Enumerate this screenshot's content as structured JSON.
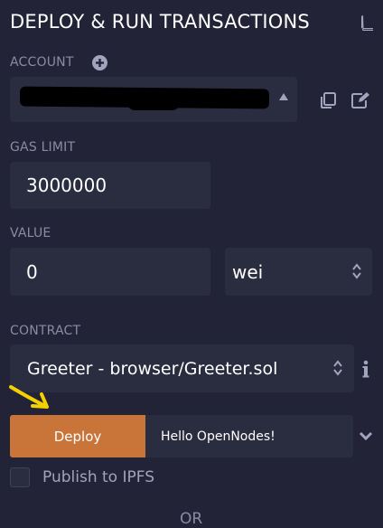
{
  "header": {
    "title": "DEPLOY & RUN TRANSACTIONS",
    "docs_icon": "book-icon"
  },
  "account": {
    "label": "ACCOUNT",
    "add_icon": "plus-circle-icon",
    "selected_value": "",
    "copy_icon": "copy-icon",
    "edit_icon": "edit-icon"
  },
  "gas": {
    "label": "GAS LIMIT",
    "value": "3000000"
  },
  "value": {
    "label": "VALUE",
    "amount": "0",
    "unit": "wei"
  },
  "contract": {
    "label": "CONTRACT",
    "selected": "Greeter - browser/Greeter.sol",
    "info_icon": "info-icon"
  },
  "deploy": {
    "button_label": "Deploy",
    "arg_value": "Hello OpenNodes!",
    "expand_icon": "chevron-down-icon"
  },
  "publish": {
    "label": "Publish to IPFS",
    "checked": false
  },
  "footer": {
    "or_label": "OR"
  },
  "colors": {
    "background": "#222336",
    "field": "#2a2c3f",
    "deploy_button": "#c97539",
    "annotation_arrow": "#f5d000"
  }
}
